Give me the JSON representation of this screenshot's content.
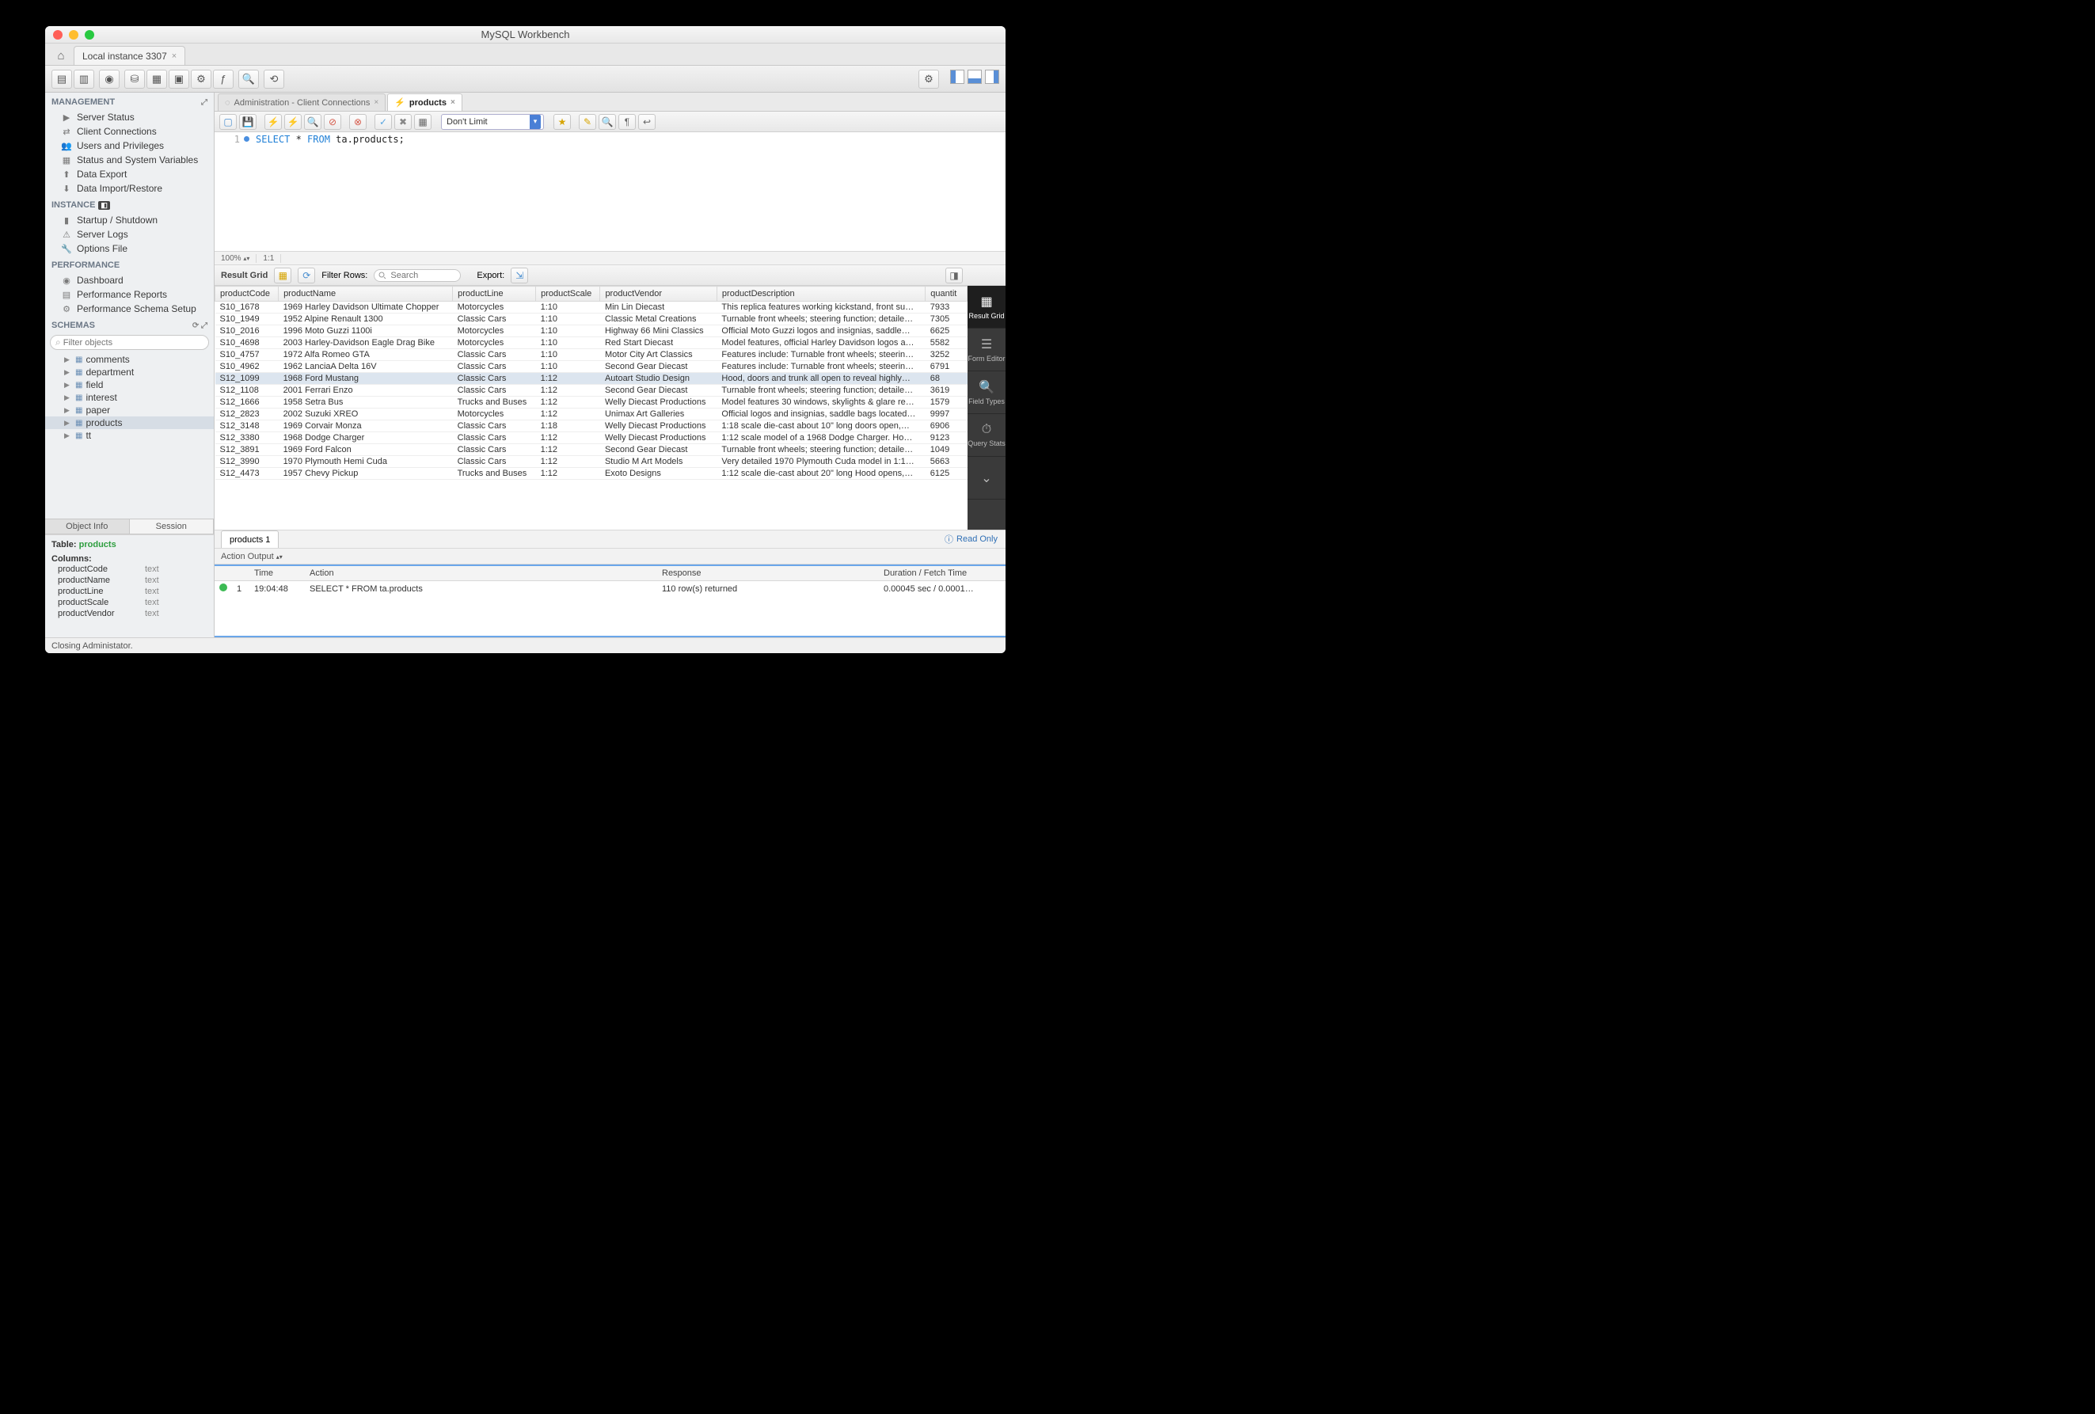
{
  "window": {
    "title": "MySQL Workbench"
  },
  "connTab": {
    "label": "Local instance 3307"
  },
  "sidebar": {
    "management": {
      "header": "MANAGEMENT",
      "items": [
        {
          "label": "Server Status"
        },
        {
          "label": "Client Connections"
        },
        {
          "label": "Users and Privileges"
        },
        {
          "label": "Status and System Variables"
        },
        {
          "label": "Data Export"
        },
        {
          "label": "Data Import/Restore"
        }
      ]
    },
    "instance": {
      "header": "INSTANCE",
      "items": [
        {
          "label": "Startup / Shutdown"
        },
        {
          "label": "Server Logs"
        },
        {
          "label": "Options File"
        }
      ]
    },
    "performance": {
      "header": "PERFORMANCE",
      "items": [
        {
          "label": "Dashboard"
        },
        {
          "label": "Performance Reports"
        },
        {
          "label": "Performance Schema Setup"
        }
      ]
    },
    "schemas": {
      "header": "SCHEMAS",
      "filterPlaceholder": "Filter objects",
      "items": [
        {
          "label": "comments"
        },
        {
          "label": "department"
        },
        {
          "label": "field"
        },
        {
          "label": "interest"
        },
        {
          "label": "paper"
        },
        {
          "label": "products",
          "selected": true
        },
        {
          "label": "tt"
        }
      ]
    },
    "infoTabs": {
      "objectInfo": "Object Info",
      "session": "Session"
    },
    "objectInfo": {
      "tableLabel": "Table:",
      "tableName": "products",
      "columnsLabel": "Columns:",
      "columns": [
        {
          "name": "productCode",
          "type": "text"
        },
        {
          "name": "productName",
          "type": "text"
        },
        {
          "name": "productLine",
          "type": "text"
        },
        {
          "name": "productScale",
          "type": "text"
        },
        {
          "name": "productVendor",
          "type": "text"
        }
      ]
    }
  },
  "editor": {
    "tabs": [
      {
        "label": "Administration - Client Connections",
        "active": false
      },
      {
        "label": "products",
        "active": true
      }
    ],
    "limit": "Don't Limit",
    "zoom": "100%",
    "pos": "1:1",
    "sql": {
      "kw1": "SELECT",
      "star": " * ",
      "kw2": "FROM",
      "rest": " ta.products;"
    },
    "resultGridLabel": "Result Grid",
    "filterRowsLabel": "Filter Rows:",
    "filterPlaceholder": "Search",
    "exportLabel": "Export:",
    "readOnly": "Read Only",
    "resultTab": "products 1"
  },
  "grid": {
    "headers": [
      "productCode",
      "productName",
      "productLine",
      "productScale",
      "productVendor",
      "productDescription",
      "quantit"
    ],
    "rows": [
      [
        "S10_1678",
        "1969 Harley Davidson Ultimate Chopper",
        "Motorcycles",
        "1:10",
        "Min Lin Diecast",
        "This replica features working kickstand, front su…",
        "7933"
      ],
      [
        "S10_1949",
        "1952 Alpine Renault 1300",
        "Classic Cars",
        "1:10",
        "Classic Metal Creations",
        "Turnable front wheels; steering function; detaile…",
        "7305"
      ],
      [
        "S10_2016",
        "1996 Moto Guzzi 1100i",
        "Motorcycles",
        "1:10",
        "Highway 66 Mini Classics",
        "Official Moto Guzzi logos and insignias, saddle…",
        "6625"
      ],
      [
        "S10_4698",
        "2003 Harley-Davidson Eagle Drag Bike",
        "Motorcycles",
        "1:10",
        "Red Start Diecast",
        "Model features, official Harley Davidson logos a…",
        "5582"
      ],
      [
        "S10_4757",
        "1972 Alfa Romeo GTA",
        "Classic Cars",
        "1:10",
        "Motor City Art Classics",
        "Features include: Turnable front wheels; steerin…",
        "3252"
      ],
      [
        "S10_4962",
        "1962 LanciaA Delta 16V",
        "Classic Cars",
        "1:10",
        "Second Gear Diecast",
        "Features include: Turnable front wheels; steerin…",
        "6791"
      ],
      [
        "S12_1099",
        "1968 Ford Mustang",
        "Classic Cars",
        "1:12",
        "Autoart Studio Design",
        "Hood, doors and trunk all open to reveal highly…",
        "68"
      ],
      [
        "S12_1108",
        "2001 Ferrari Enzo",
        "Classic Cars",
        "1:12",
        "Second Gear Diecast",
        "Turnable front wheels; steering function; detaile…",
        "3619"
      ],
      [
        "S12_1666",
        "1958 Setra Bus",
        "Trucks and Buses",
        "1:12",
        "Welly Diecast Productions",
        "Model features 30 windows, skylights & glare re…",
        "1579"
      ],
      [
        "S12_2823",
        "2002 Suzuki XREO",
        "Motorcycles",
        "1:12",
        "Unimax Art Galleries",
        "Official logos and insignias, saddle bags located…",
        "9997"
      ],
      [
        "S12_3148",
        "1969 Corvair Monza",
        "Classic Cars",
        "1:18",
        "Welly Diecast Productions",
        "1:18 scale die-cast about 10\" long doors open,…",
        "6906"
      ],
      [
        "S12_3380",
        "1968 Dodge Charger",
        "Classic Cars",
        "1:12",
        "Welly Diecast Productions",
        "1:12 scale model of a 1968 Dodge Charger. Ho…",
        "9123"
      ],
      [
        "S12_3891",
        "1969 Ford Falcon",
        "Classic Cars",
        "1:12",
        "Second Gear Diecast",
        "Turnable front wheels; steering function; detaile…",
        "1049"
      ],
      [
        "S12_3990",
        "1970 Plymouth Hemi Cuda",
        "Classic Cars",
        "1:12",
        "Studio M Art Models",
        "Very detailed 1970 Plymouth Cuda model in 1:1…",
        "5663"
      ],
      [
        "S12_4473",
        "1957 Chevy Pickup",
        "Trucks and Buses",
        "1:12",
        "Exoto Designs",
        "1:12 scale die-cast about 20\" long Hood opens,…",
        "6125"
      ]
    ],
    "selectedRow": 6
  },
  "sidepanel": {
    "tabs": [
      {
        "label": "Result Grid",
        "active": true
      },
      {
        "label": "Form Editor"
      },
      {
        "label": "Field Types"
      },
      {
        "label": "Query Stats"
      }
    ]
  },
  "output": {
    "dropdown": "Action Output",
    "headers": {
      "time": "Time",
      "action": "Action",
      "response": "Response",
      "duration": "Duration / Fetch Time"
    },
    "row": {
      "num": "1",
      "time": "19:04:48",
      "action": "SELECT * FROM ta.products",
      "response": "110 row(s) returned",
      "duration": "0.00045 sec / 0.0001…"
    }
  },
  "statusbar": {
    "text": "Closing Administator."
  }
}
